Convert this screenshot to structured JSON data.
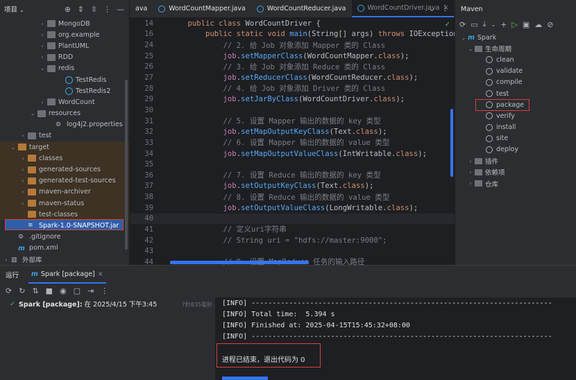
{
  "project": {
    "title": "项目",
    "tree": [
      {
        "label": "MongoDB",
        "type": "folder",
        "indent": 56,
        "arrow": "›"
      },
      {
        "label": "org.example",
        "type": "folder",
        "indent": 56,
        "arrow": "›"
      },
      {
        "label": "PlantUML",
        "type": "folder",
        "indent": 56,
        "arrow": "›"
      },
      {
        "label": "RDD",
        "type": "folder",
        "indent": 56,
        "arrow": "›"
      },
      {
        "label": "redis",
        "type": "folder",
        "indent": 56,
        "arrow": "⌄"
      },
      {
        "label": "TestRedis",
        "type": "class",
        "indent": 82,
        "arrow": ""
      },
      {
        "label": "TestRedis2",
        "type": "class",
        "indent": 82,
        "arrow": ""
      },
      {
        "label": "WordCount",
        "type": "folder",
        "indent": 56,
        "arrow": "›"
      },
      {
        "label": "resources",
        "type": "folder",
        "indent": 42,
        "arrow": "⌄"
      },
      {
        "label": "log4j2.properties",
        "type": "file",
        "indent": 68,
        "arrow": ""
      },
      {
        "label": "test",
        "type": "folder",
        "indent": 28,
        "arrow": "›"
      },
      {
        "label": "target",
        "type": "folder-orange",
        "indent": 14,
        "arrow": "⌄",
        "hl": true
      },
      {
        "label": "classes",
        "type": "folder-orange",
        "indent": 28,
        "arrow": "›",
        "hl": true
      },
      {
        "label": "generated-sources",
        "type": "folder-orange",
        "indent": 28,
        "arrow": "›",
        "hl": true
      },
      {
        "label": "generated-test-sources",
        "type": "folder-orange",
        "indent": 28,
        "arrow": "›",
        "hl": true
      },
      {
        "label": "maven-archiver",
        "type": "folder-orange",
        "indent": 28,
        "arrow": "›",
        "hl": true
      },
      {
        "label": "maven-status",
        "type": "folder-orange",
        "indent": 28,
        "arrow": "›",
        "hl": true
      },
      {
        "label": "test-classes",
        "type": "folder-orange",
        "indent": 28,
        "arrow": "",
        "hl": true
      },
      {
        "label": "Spark-1.0-SNAPSHOT.jar",
        "type": "jar",
        "indent": 28,
        "arrow": "",
        "selected": true
      },
      {
        "label": ".gitignore",
        "type": "file",
        "indent": 14,
        "arrow": ""
      },
      {
        "label": "pom.xml",
        "type": "maven",
        "indent": 14,
        "arrow": ""
      },
      {
        "label": "外部库",
        "type": "lib",
        "indent": 4,
        "arrow": "›"
      }
    ]
  },
  "editor": {
    "tabs": [
      {
        "label": "ava",
        "active": false,
        "icon": false
      },
      {
        "label": "WordCountMapper.java",
        "active": false,
        "icon": true
      },
      {
        "label": "WordCountReducer.java",
        "active": false,
        "icon": true
      },
      {
        "label": "WordCountDriver.java",
        "active": true,
        "icon": true
      },
      {
        "label": "HE",
        "active": false,
        "icon": true
      }
    ],
    "lines": [
      {
        "n": "14",
        "html": "    <span class='kw'>public class</span> WordCountDriver {"
      },
      {
        "n": "16",
        "html": "        <span class='kw'>public static void</span> <span class='fn'>main</span>(String[] args) <span class='kw'>throws</span> IOException, Int"
      },
      {
        "n": "24",
        "html": "            <span class='cm'>// 2. 给 Job 对象添加 Mapper 类的 Class</span>"
      },
      {
        "n": "25",
        "html": "            <span class='var'>job</span>.<span class='fn'>setMapperClass</span>(WordCountMapper.<span class='kw'>class</span>);"
      },
      {
        "n": "26",
        "html": "            <span class='cm'>// 3. 给 Job 对象添加 Reduce 类的 Class</span>"
      },
      {
        "n": "27",
        "html": "            <span class='var'>job</span>.<span class='fn'>setReducerClass</span>(WordCountReducer.<span class='kw'>class</span>);"
      },
      {
        "n": "28",
        "html": "            <span class='cm'>// 4. 给 Job 对象添加 Driver 类的 Class</span>"
      },
      {
        "n": "29",
        "html": "            <span class='var'>job</span>.<span class='fn'>setJarByClass</span>(WordCountDriver.<span class='kw'>class</span>);"
      },
      {
        "n": "30",
        "html": ""
      },
      {
        "n": "31",
        "html": "            <span class='cm'>// 5. 设置 Mapper 输出的数据的 key 类型</span>"
      },
      {
        "n": "32",
        "html": "            <span class='var'>job</span>.<span class='fn'>setMapOutputKeyClass</span>(Text.<span class='kw'>class</span>);"
      },
      {
        "n": "33",
        "html": "            <span class='cm'>// 6. 设置 Mapper 输出的数据的 value 类型</span>"
      },
      {
        "n": "34",
        "html": "            <span class='var'>job</span>.<span class='fn'>setMapOutputValueClass</span>(IntWritable.<span class='kw'>class</span>);"
      },
      {
        "n": "35",
        "html": ""
      },
      {
        "n": "36",
        "html": "            <span class='cm'>// 7. 设置 Reduce 输出的数据的 key 类型</span>"
      },
      {
        "n": "37",
        "html": "            <span class='var'>job</span>.<span class='fn'>setOutputKeyClass</span>(Text.<span class='kw'>class</span>);"
      },
      {
        "n": "38",
        "html": "            <span class='cm'>// 8. 设置 Reduce 输出的数据的 value 类型</span>"
      },
      {
        "n": "39",
        "html": "            <span class='var'>job</span>.<span class='fn'>setOutputValueClass</span>(LongWritable.<span class='kw'>class</span>);"
      },
      {
        "n": "40",
        "html": "",
        "cur": true
      },
      {
        "n": "41",
        "html": "            <span class='cm'>// 定义uri字符串</span>"
      },
      {
        "n": "42",
        "html": "            <span class='cm'>// String uri = \"hdfs://master:9000\";</span>"
      },
      {
        "n": "43",
        "html": ""
      },
      {
        "n": "44",
        "html": "            <span class='cm'>// 9. 设置 MapReduce 任务的输入路径</span>"
      }
    ]
  },
  "maven": {
    "title": "Maven",
    "items": [
      {
        "label": "Spark",
        "indent": 6,
        "arrow": "⌄",
        "type": "maven"
      },
      {
        "label": "生命周期",
        "indent": 16,
        "arrow": "⌄",
        "type": "folder"
      },
      {
        "label": "clean",
        "indent": 44,
        "arrow": "",
        "type": "gear"
      },
      {
        "label": "validate",
        "indent": 44,
        "arrow": "",
        "type": "gear"
      },
      {
        "label": "compile",
        "indent": 44,
        "arrow": "",
        "type": "gear"
      },
      {
        "label": "test",
        "indent": 44,
        "arrow": "",
        "type": "gear"
      },
      {
        "label": "package",
        "indent": 44,
        "arrow": "",
        "type": "gear"
      },
      {
        "label": "verify",
        "indent": 44,
        "arrow": "",
        "type": "gear"
      },
      {
        "label": "install",
        "indent": 44,
        "arrow": "",
        "type": "gear"
      },
      {
        "label": "site",
        "indent": 44,
        "arrow": "",
        "type": "gear"
      },
      {
        "label": "deploy",
        "indent": 44,
        "arrow": "",
        "type": "gear"
      },
      {
        "label": "插件",
        "indent": 16,
        "arrow": "›",
        "type": "folder"
      },
      {
        "label": "依赖项",
        "indent": 16,
        "arrow": "›",
        "type": "folder"
      },
      {
        "label": "仓库",
        "indent": 16,
        "arrow": "›",
        "type": "folder"
      }
    ]
  },
  "run": {
    "title": "运行",
    "tab": "Spark [package]",
    "item_label": "Spark [package]:",
    "item_detail": " 在 2025/4/15 下午3:45",
    "item_time": "7秒835毫秒",
    "console": [
      "[INFO] ------------------------------------------------------------------------",
      "[INFO] Total time:  5.394 s",
      "[INFO] Finished at: 2025-04-15T15:45:32+08:00",
      "[INFO] ------------------------------------------------------------------------",
      "",
      "进程已结束，退出代码为 0"
    ]
  }
}
